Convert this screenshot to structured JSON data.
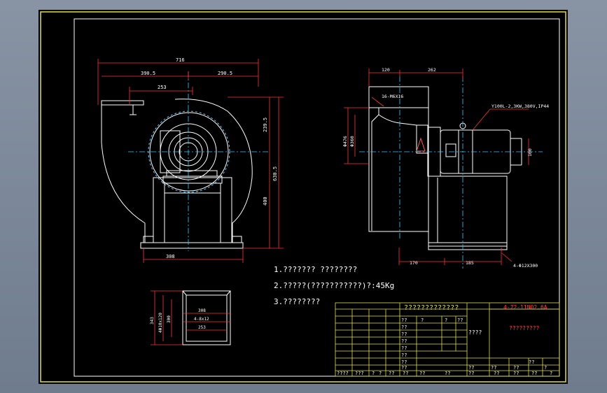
{
  "dims": {
    "front_overall_w": "716",
    "front_left_w": "390.5",
    "front_right_w": "290.5",
    "front_inlet_w": "253",
    "front_h1": "239.5",
    "front_h2": "630.5",
    "front_h3": "400",
    "front_base": "308",
    "side_top_left": "120",
    "side_top_right": "262",
    "side_hole_label": "16-M6X16",
    "side_d1": "Φ476",
    "side_d2": "Φ360",
    "motor_label": "Y100L-2,3KW,380V,IP44",
    "side_motor_h": "100",
    "side_base_left": "170",
    "side_base_right": "185",
    "side_base_note": "4-Φ12X300",
    "outlet_w": "308",
    "outlet_inner": "4-8x12",
    "outlet_w2": "253",
    "outlet_h_out": "343",
    "outlet_h1": "4Φ10x120",
    "outlet_h2": "300"
  },
  "notes": [
    "1.??????? ????????",
    "2.?????(???????????)?:45Kg",
    "3.????????"
  ],
  "title_block": {
    "title": "?????????????",
    "code": "4-72-11NO2.6A",
    "subtitle": "?????????",
    "scale_label": "????",
    "cells": [
      "??",
      "?",
      "?",
      "??",
      "??",
      "??",
      "??",
      "??",
      "??",
      "??",
      "??",
      "??",
      "??",
      "??",
      "??",
      "?"
    ],
    "bottom": [
      "????",
      "???",
      "?",
      "?",
      "??",
      "??",
      "??",
      "??",
      "??",
      "??",
      "??",
      "??",
      "?"
    ]
  }
}
